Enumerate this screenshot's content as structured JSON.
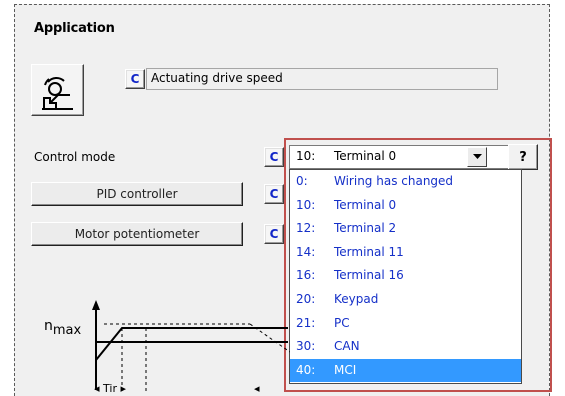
{
  "section": {
    "title": "Application"
  },
  "application": {
    "icon": "drive-speed-icon",
    "c_label": "C",
    "value": "Actuating drive speed"
  },
  "control_mode": {
    "label": "Control mode",
    "c_label": "C",
    "selected": {
      "code": "10:",
      "label": "Terminal 0"
    },
    "help_label": "?"
  },
  "buttons": {
    "pid": {
      "label": "PID controller",
      "c_label": "C"
    },
    "motor_pot": {
      "label": "Motor potentiometer",
      "c_label": "C"
    }
  },
  "dropdown": {
    "options": [
      {
        "code": "0:",
        "label": "Wiring has changed"
      },
      {
        "code": "10:",
        "label": "Terminal 0"
      },
      {
        "code": "12:",
        "label": "Terminal 2"
      },
      {
        "code": "14:",
        "label": "Terminal 11"
      },
      {
        "code": "16:",
        "label": "Terminal 16"
      },
      {
        "code": "20:",
        "label": "Keypad"
      },
      {
        "code": "21:",
        "label": "PC"
      },
      {
        "code": "30:",
        "label": "CAN"
      },
      {
        "code": "40:",
        "label": "MCI"
      }
    ],
    "selected_index": 8
  },
  "graph": {
    "n_symbol": "n",
    "n_subscript": "max",
    "tir_label": "Tir"
  },
  "colors": {
    "link_blue": "#1530c8",
    "selection": "#3399ff",
    "highlight_border": "#c0504d"
  }
}
